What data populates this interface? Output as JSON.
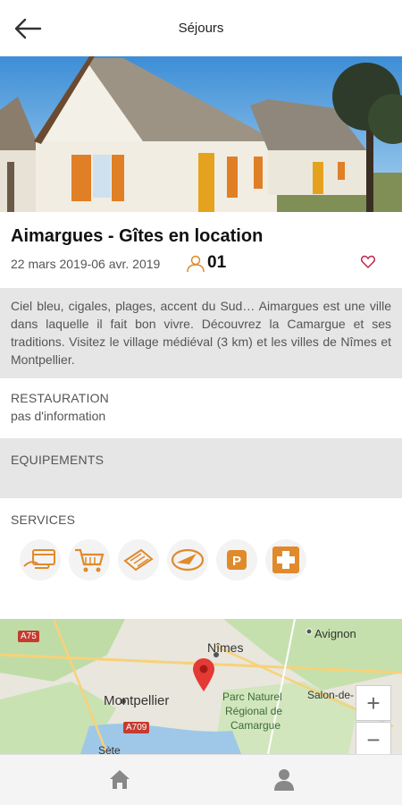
{
  "header": {
    "title": "Séjours"
  },
  "listing": {
    "title": "Aimargues - Gîtes en location",
    "dates": "22 mars 2019-06 avr. 2019",
    "guests": "01",
    "description": "Ciel bleu, cigales, plages, accent du Sud… Aimargues est une ville dans laquelle il fait bon vivre. Découvrez la Camargue et ses traditions. Visitez le village médiéval (3 km) et les villes de Nîmes et Montpellier."
  },
  "restauration": {
    "label": "RESTAURATION",
    "value": "pas d'information"
  },
  "equipements": {
    "label": "EQUIPEMENTS"
  },
  "services": {
    "label": "SERVICES",
    "items": [
      "card-payment-icon",
      "shopping-cart-icon",
      "newspaper-icon",
      "post-office-icon",
      "parking-icon",
      "first-aid-icon"
    ]
  },
  "map": {
    "labels": {
      "a75": "A75",
      "nimes": "Nîmes",
      "avignon": "Avignon",
      "montpellier": "Montpellier",
      "parc": "Parc Naturel",
      "parc2": "Régional de",
      "parc3": "Camargue",
      "salon": "Salon-de-",
      "a709": "A709",
      "sete": "Sète"
    },
    "zoom_in": "+",
    "zoom_out": "−"
  },
  "colors": {
    "accent": "#e08a2c",
    "heart": "#c0264b",
    "pin": "#e53935"
  }
}
